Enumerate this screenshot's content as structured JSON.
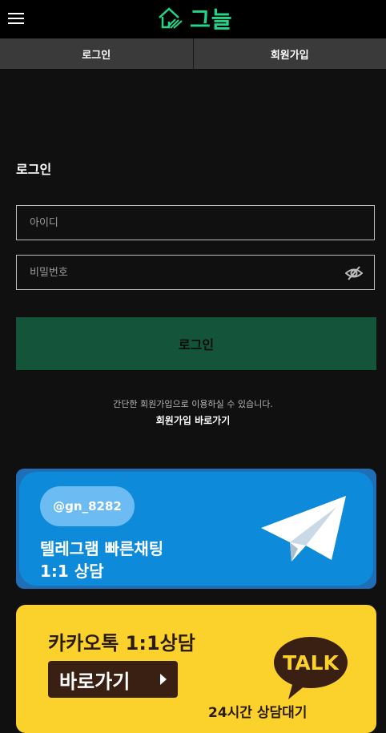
{
  "header": {
    "logo_text": "그늘",
    "brand_color": "#1fd68a"
  },
  "tabs": [
    {
      "label": "로그인"
    },
    {
      "label": "회원가입"
    }
  ],
  "login": {
    "title": "로그인",
    "id_placeholder": "아이디",
    "password_placeholder": "비밀번호",
    "submit_label": "로그인",
    "hint": "간단한 회원가입으로 이용하실 수 있습니다.",
    "signup_link": "회원가입 바로가기"
  },
  "banners": {
    "telegram": {
      "handle": "@gn_8282",
      "line1": "텔레그램 빠른채팅",
      "line2": "1:1 상담"
    },
    "kakao": {
      "title": "카카오톡 1:1상담",
      "button": "바로가기",
      "talk": "TALK",
      "bottom": "24시간 상담대기"
    }
  },
  "icons": {
    "menu": "menu-icon",
    "logo": "house-logo-icon",
    "eye": "eye-off-icon",
    "telegram": "paper-plane-icon",
    "kakao": "talk-bubble-icon"
  }
}
